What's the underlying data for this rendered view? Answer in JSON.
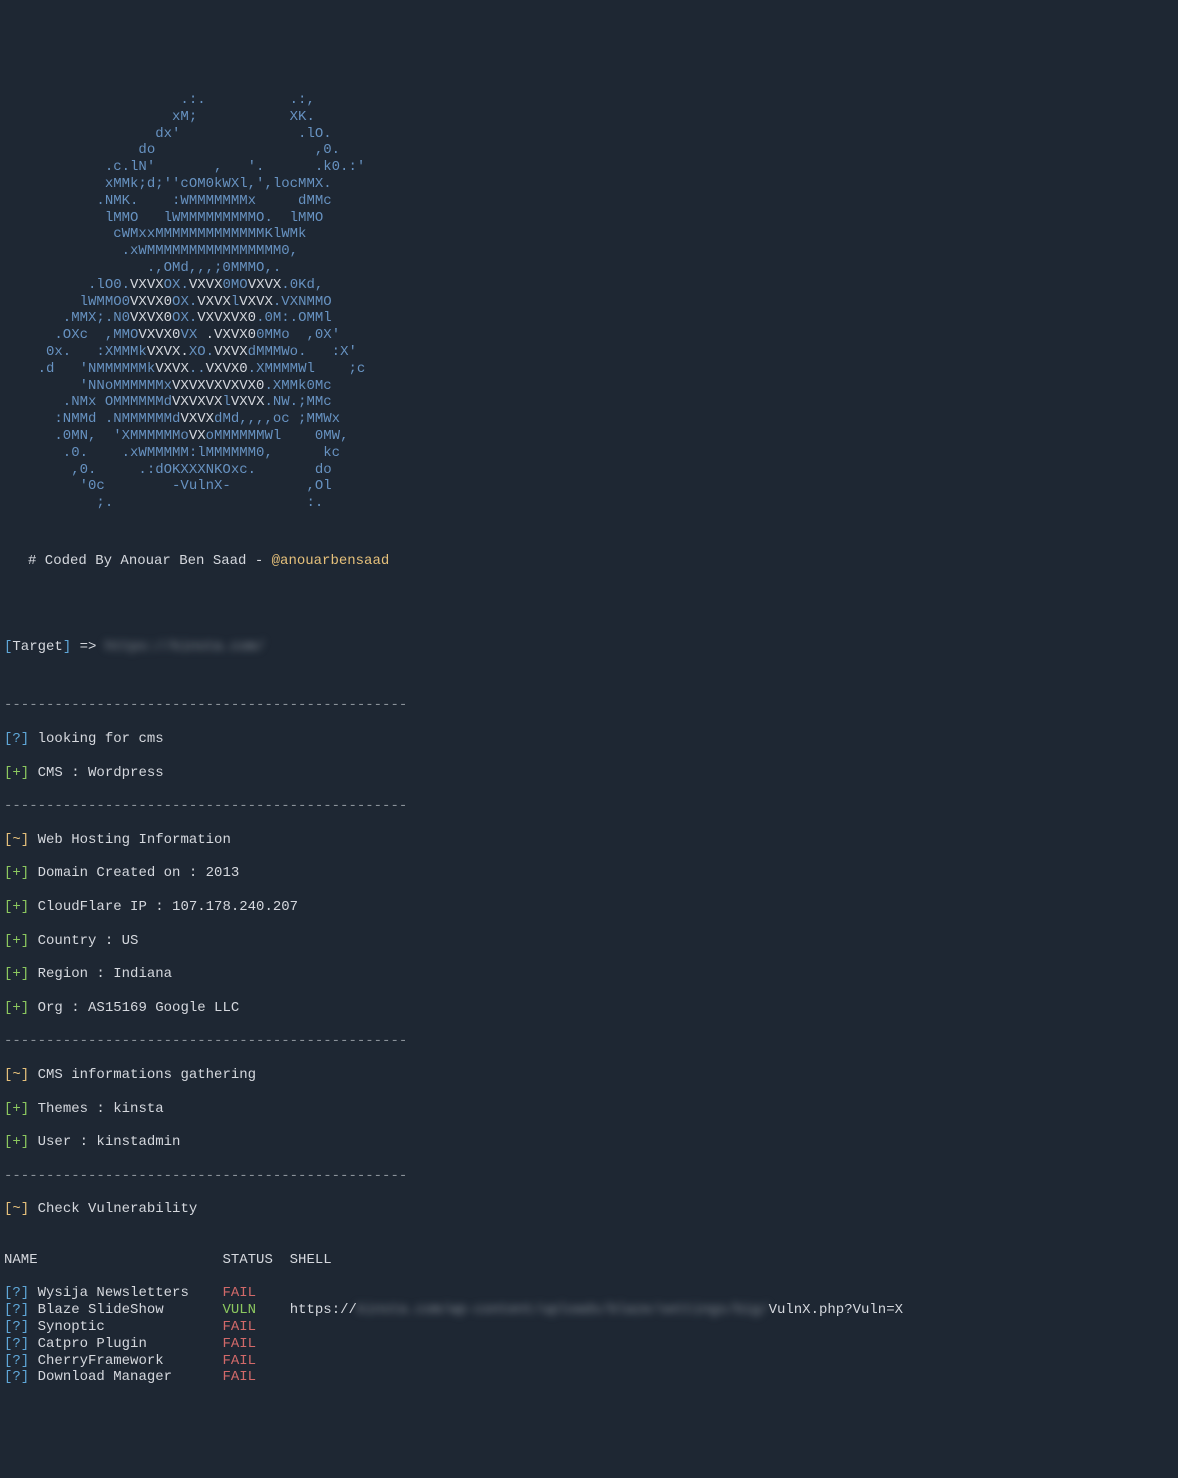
{
  "ascii": {
    "l01": "                     .:.          .:,                     ",
    "l02": "                    xM;           XK.                    ",
    "l03": "                  dx'              .lO.                  ",
    "l04": "                do                   ,0.                ",
    "l05": "            .c.lN'       ,   '.      .k0.:'            ",
    "l06": "            xMMk;d;''cOM0kWXl,',locMMX.             ",
    "l07": "           .NMK.    :WMMMMMMMx     dMMc             ",
    "l08": "            lMMO   lWMMMMMMMMMO.  lMMO              ",
    "l09": "             cWMxxMMMMMMMMMMMMMKlWMk               ",
    "l10": "              .xWMMMMMMMMMMMMMMMM0,                ",
    "l11": "                 .,OMd,,,;0MMMO,.                  ",
    "l12a": "          .lO0.",
    "l12b": "VXVX",
    "l12c": "OX.",
    "l12d": "VXVX",
    "l12e": "0MO",
    "l12f": "VXVX",
    "l12g": ".0Kd,          ",
    "l13a": "         lWMMO0",
    "l13b": "VXVX0",
    "l13c": "OX.",
    "l13d": "VXVX",
    "l13e": "l",
    "l13f": "VXVX",
    "l13g": ".VXNMMO         ",
    "l14a": "       .MMX;.N0",
    "l14b": "VXVX0",
    "l14c": "OX.",
    "l14d": "VXVXVX0",
    "l14e": ".0M:.OMMl       ",
    "l15a": "      .OXc  ,MMO",
    "l15b": "VXVX0",
    "l15c": "VX ",
    "l15d": ".VXVX0",
    "l15e": "0MMo  ,0X'      ",
    "l16a": "     0x.   :XMMMk",
    "l16b": "VXVX.",
    "l16c": "XO.",
    "l16d": "VXVX",
    "l16e": "dMMMWo.   :X'     ",
    "l17a": "    .d   'NMMMMMMk",
    "l17b": "VXVX",
    "l17c": "..",
    "l17d": "VXVX0",
    "l17e": ".XMMMMWl    ;c    ",
    "l18a": "         'NNoMMMMMMx",
    "l18b": "VXVXVXVXVX0",
    "l18c": ".XMMk0Mc          ",
    "l19a": "       .NMx OMMMMMMd",
    "l19b": "VXVXVX",
    "l19c": "l",
    "l19d": "VXVX",
    "l19e": ".NW.;MMc       ",
    "l20a": "      :NMMd .NMMMMMMd",
    "l20b": "VXVX",
    "l20c": "dMd,,,,oc ;MMWx      ",
    "l21a": "      .0MN,  'XMMMMMMo",
    "l21b": "VX",
    "l21c": "oMMMMMMWl    0MW,     ",
    "l22": "       .0.    .xWMMMMM:lMMMMMM0,      kc       ",
    "l23": "        ,0.     .:dOKXXXNKOxc.       do        ",
    "l24": "         '0c        -VulnX-         ,Ol         ",
    "l25": "           ;.                       :.           "
  },
  "credit": {
    "prefix": "# Coded By Anouar Ben Saad - ",
    "handle": "@anouarbensaad"
  },
  "target": {
    "label": "Target",
    "arrow": " => ",
    "url": "https://kinsta.com/"
  },
  "separator": "------------------------------------------------",
  "sections": {
    "cms_look": {
      "tag": "?",
      "text": "looking for cms"
    },
    "cms_found": {
      "tag": "+",
      "text": "CMS : Wordpress"
    },
    "hosting_header": {
      "tag": "~",
      "text": "Web Hosting Information"
    },
    "hosting": [
      {
        "tag": "+",
        "text": "Domain Created on : 2013"
      },
      {
        "tag": "+",
        "text": "CloudFlare IP : 107.178.240.207"
      },
      {
        "tag": "+",
        "text": "Country : US"
      },
      {
        "tag": "+",
        "text": "Region : Indiana"
      },
      {
        "tag": "+",
        "text": "Org : AS15169 Google LLC"
      }
    ],
    "cms_info_header": {
      "tag": "~",
      "text": "CMS informations gathering"
    },
    "cms_info": [
      {
        "tag": "+",
        "text": "Themes : kinsta"
      },
      {
        "tag": "+",
        "text": "User : kinstadmin"
      }
    ],
    "vuln_header": {
      "tag": "~",
      "text": "Check Vulnerability"
    }
  },
  "table": {
    "headers": {
      "name": "NAME",
      "status": "STATUS",
      "shell": "SHELL"
    },
    "rows": [
      {
        "name": "Wysija Newsletters",
        "status": "FAIL",
        "shell": ""
      },
      {
        "name": "Blaze SlideShow",
        "status": "VULN",
        "shell_pre": "https://",
        "shell_blur": "kinsta.com/wp-content/uploads/blaze/settings/big/",
        "shell_post": "VulnX.php?Vuln=X"
      },
      {
        "name": "Synoptic",
        "status": "FAIL",
        "shell": ""
      },
      {
        "name": "Catpro Plugin",
        "status": "FAIL",
        "shell": ""
      },
      {
        "name": "CherryFramework",
        "status": "FAIL",
        "shell": ""
      },
      {
        "name": "Download Manager",
        "status": "FAIL",
        "shell": ""
      }
    ]
  }
}
